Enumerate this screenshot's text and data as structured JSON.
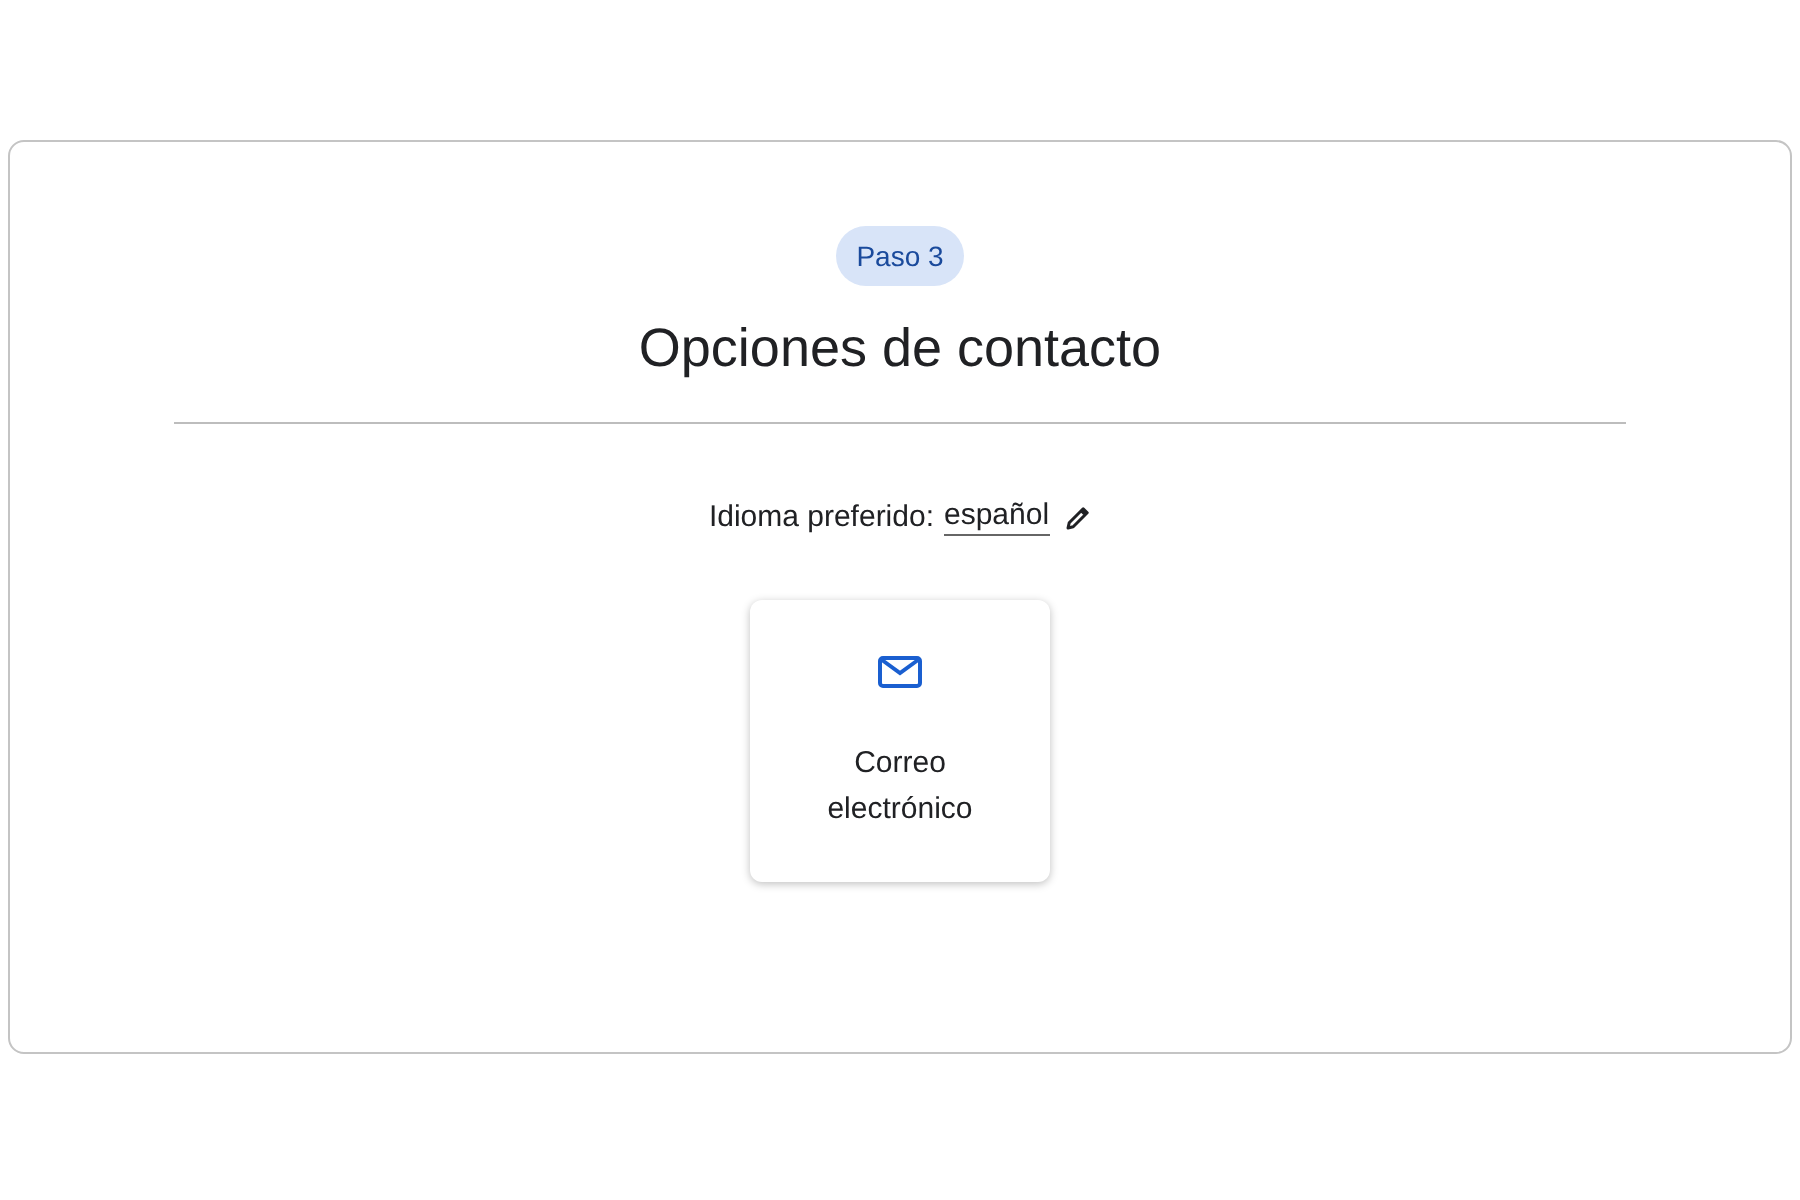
{
  "step_badge": "Paso 3",
  "title": "Opciones de contacto",
  "language": {
    "label": "Idioma preferido:",
    "value": "español"
  },
  "options": [
    {
      "kind": "email",
      "label": "Correo electrónico"
    }
  ]
}
